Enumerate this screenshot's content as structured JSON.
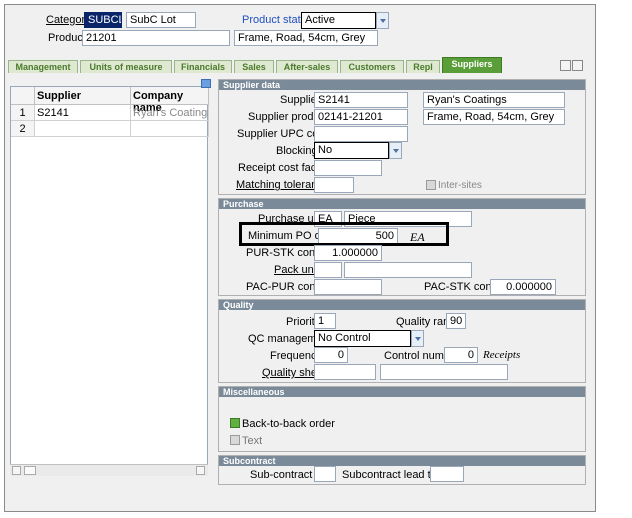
{
  "header": {
    "category_label": "Category",
    "category_code": "SUBCL",
    "category_name": "SubC Lot",
    "product_status_label": "Product status",
    "product_status_value": "Active",
    "product_label": "Product",
    "product_code": "21201",
    "product_desc": "Frame, Road, 54cm, Grey"
  },
  "tabs": [
    {
      "label": "Management"
    },
    {
      "label": "Units of measure"
    },
    {
      "label": "Financials"
    },
    {
      "label": "Sales"
    },
    {
      "label": "After-sales"
    },
    {
      "label": "Customers"
    },
    {
      "label": "Repl"
    },
    {
      "label": "Suppliers"
    }
  ],
  "grid": {
    "col_supplier": "Supplier",
    "col_company": "Company name",
    "rows": [
      {
        "num": "1",
        "supplier": "S2141",
        "company": "Ryan's Coatings"
      },
      {
        "num": "2",
        "supplier": "",
        "company": ""
      }
    ]
  },
  "supplier_data": {
    "title": "Supplier data",
    "supplier_label": "Supplier",
    "supplier_code": "S2141",
    "supplier_name": "Ryan's Coatings",
    "supplier_product_label": "Supplier product",
    "supplier_product_code": "02141-21201",
    "supplier_product_desc": "Frame, Road, 54cm, Grey",
    "upc_label": "Supplier UPC code",
    "blocking_label": "Blocking",
    "blocking_value": "No",
    "receipt_cost_label": "Receipt cost factor",
    "matching_tol_label": "Matching tolerance",
    "inter_sites_label": "Inter-sites"
  },
  "purchase": {
    "title": "Purchase",
    "purchase_unit_label": "Purchase unit",
    "purchase_unit_code": "EA",
    "purchase_unit_name": "Piece",
    "min_po_label": "Minimum PO qty",
    "min_po_value": "500",
    "min_po_unit": "EA",
    "pur_stk_label": "PUR-STK conv",
    "pur_stk_value": "1.000000",
    "pack_unit_label": "Pack unit",
    "pac_pur_label": "PAC-PUR conv",
    "pac_stk_label": "PAC-STK conv",
    "pac_stk_value": "0.000000"
  },
  "quality": {
    "title": "Quality",
    "priority_label": "Priority",
    "priority_value": "1",
    "quality_rank_label": "Quality rank",
    "quality_rank_value": "90",
    "qc_label": "QC management",
    "qc_value": "No Control",
    "frequency_label": "Frequency",
    "frequency_value": "0",
    "control_number_label": "Control number",
    "control_number_value": "0",
    "receipts_label": "Receipts",
    "quality_sheet_label": "Quality sheet"
  },
  "misc": {
    "title": "Miscellaneous",
    "back_to_back_label": "Back-to-back order",
    "text_label": "Text"
  },
  "subcontract": {
    "title": "Subcontract",
    "alt_label": "Sub-contract alt",
    "lead_label": "Subcontract lead tim..."
  }
}
